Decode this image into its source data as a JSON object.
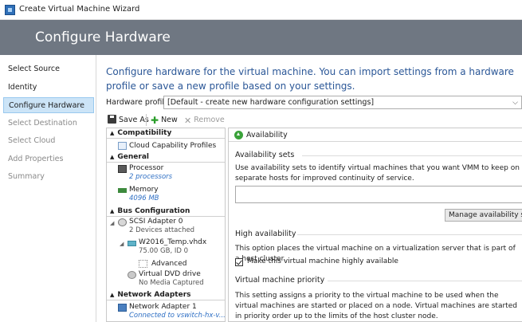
{
  "window": {
    "title": "Create Virtual Machine Wizard"
  },
  "header": {
    "title": "Configure Hardware"
  },
  "nav": {
    "items": [
      {
        "label": "Select Source",
        "state": "normal"
      },
      {
        "label": "Identity",
        "state": "normal"
      },
      {
        "label": "Configure Hardware",
        "state": "active"
      },
      {
        "label": "Select Destination",
        "state": "disabled"
      },
      {
        "label": "Select Cloud",
        "state": "disabled"
      },
      {
        "label": "Add Properties",
        "state": "disabled"
      },
      {
        "label": "Summary",
        "state": "disabled"
      }
    ]
  },
  "main": {
    "intro": "Configure hardware for the virtual machine. You can import settings from a hardware profile or save a new profile based on your settings.",
    "hardware_profile_label": "Hardware profile:",
    "hardware_profile_value": "[Default - create new hardware configuration settings]",
    "toolbar": {
      "save_as": "Save As",
      "new": "New",
      "remove": "Remove"
    }
  },
  "tree": {
    "compatibility": "Compatibility",
    "cloud_profiles": "Cloud Capability Profiles",
    "general": "General",
    "processor": {
      "label": "Processor",
      "sub": "2 processors"
    },
    "memory": {
      "label": "Memory",
      "sub": "4096 MB"
    },
    "bus": "Bus Configuration",
    "scsi": {
      "label": "SCSI Adapter 0",
      "sub": "2 Devices attached"
    },
    "vhdx": {
      "label": "W2016_Temp.vhdx",
      "sub": "75.00 GB, ID 0"
    },
    "advanced": "Advanced",
    "dvd": {
      "label": "Virtual DVD drive",
      "sub": "No Media Captured"
    },
    "network": "Network Adapters",
    "nic": {
      "label": "Network Adapter 1",
      "sub": "Connected to vswitch-hx-v..."
    }
  },
  "details": {
    "title": "Availability",
    "availability_sets": {
      "heading": "Availability sets",
      "description": "Use availability sets to identify virtual machines that you want VMM to keep on separate hosts for improved continuity of service.",
      "manage_button": "Manage availability sets"
    },
    "high_availability": {
      "heading": "High availability",
      "description": "This option places the virtual machine on a virtualization server that is part of a host cluster.",
      "checkbox_label": "Make this virtual machine highly available",
      "checked": true
    },
    "priority": {
      "heading": "Virtual machine priority",
      "description": "This setting assigns a priority to the virtual machine to be used when the virtual machines are started or placed on a node. Virtual machines are started in priority order up to the limits of the host cluster node."
    }
  },
  "colors": {
    "header": "#6f7782",
    "accent_text": "#2b5797",
    "nav_active": "#cce4f7"
  }
}
